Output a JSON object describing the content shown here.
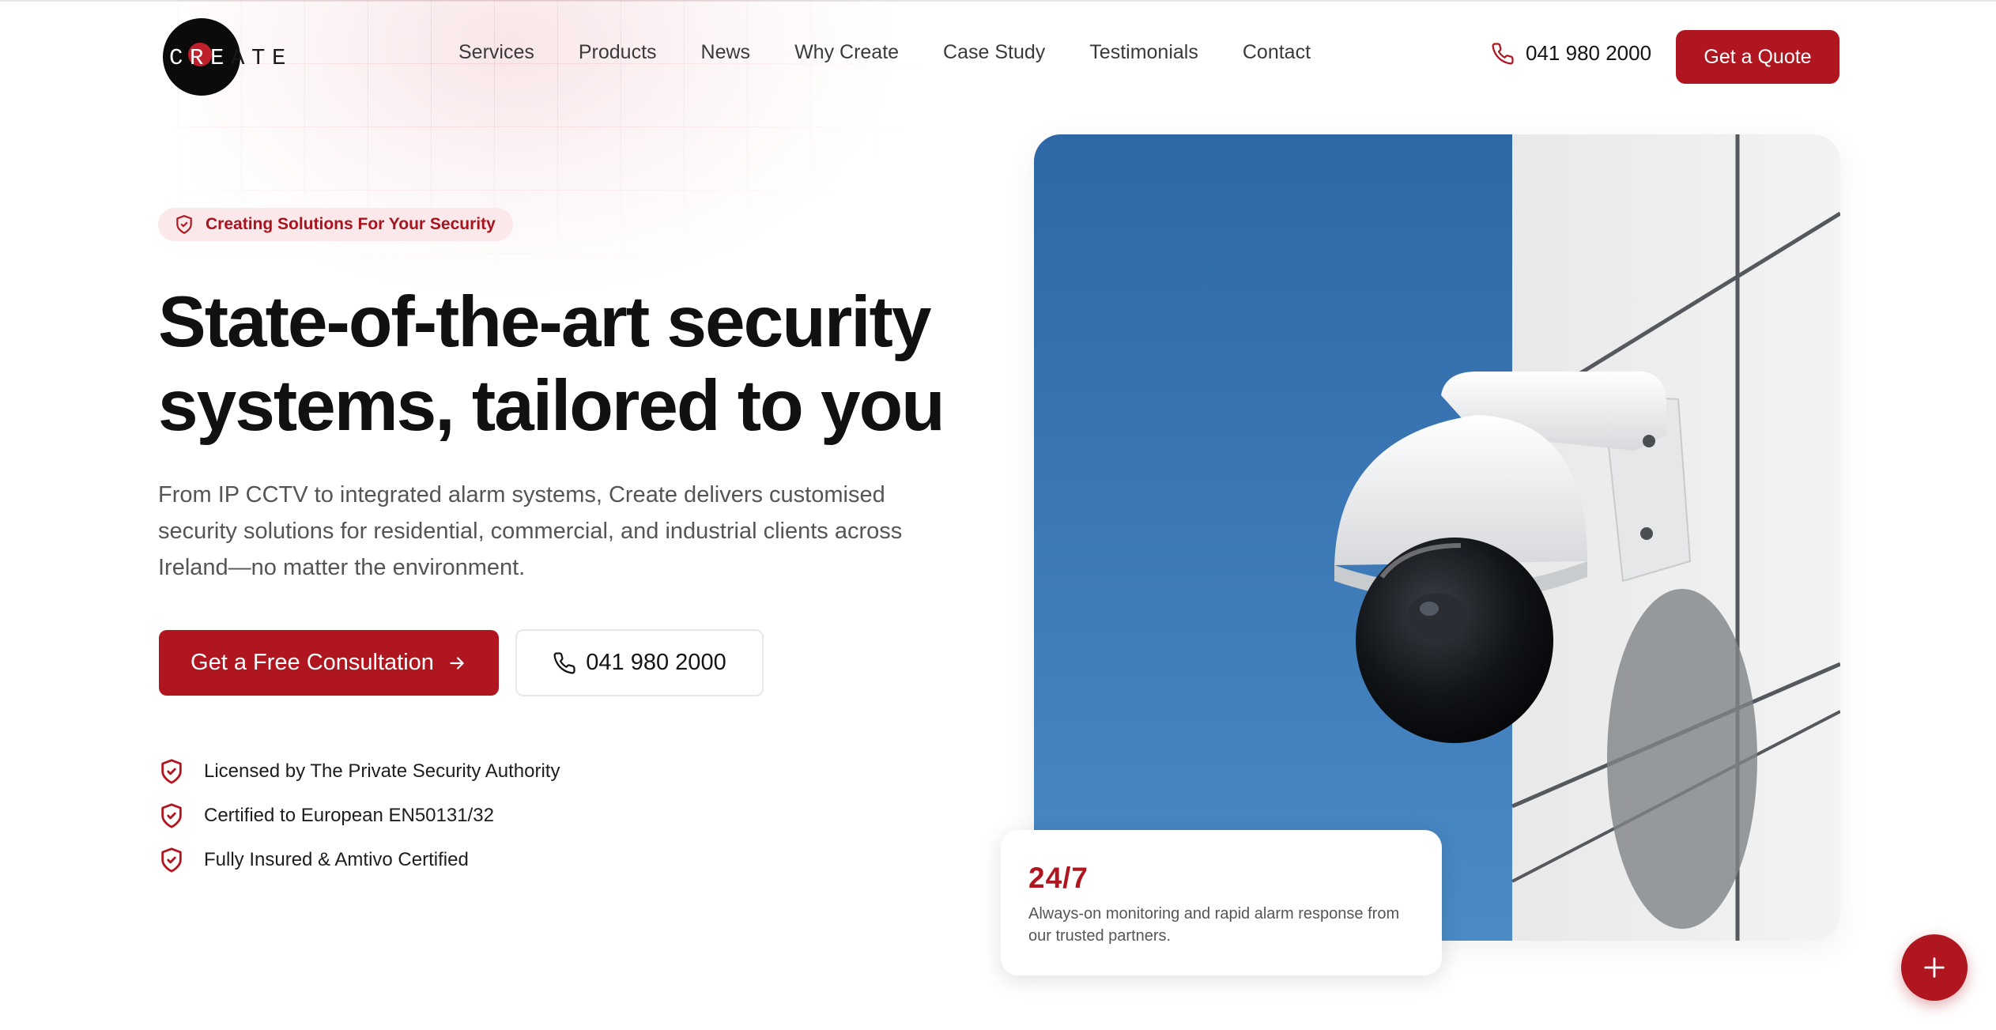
{
  "brand": {
    "logo_letters": [
      "C",
      "R",
      "E",
      "A",
      "T",
      "E"
    ]
  },
  "nav": {
    "items": [
      {
        "label": "Services"
      },
      {
        "label": "Products"
      },
      {
        "label": "News"
      },
      {
        "label": "Why Create"
      },
      {
        "label": "Case Study"
      },
      {
        "label": "Testimonials"
      },
      {
        "label": "Contact"
      }
    ]
  },
  "header": {
    "phone": "041 980 2000",
    "phone_icon": "phone-icon",
    "cta_label": "Get a Quote"
  },
  "hero": {
    "badge_icon": "shield-check-icon",
    "badge_text": "Creating Solutions For Your Security",
    "headline_line1": "State-of-the-art security",
    "headline_line2": "systems, tailored to you",
    "lede": "From IP CCTV to integrated alarm systems, Create delivers customised security solutions for residential, commercial, and industrial clients across Ireland—no matter the environment.",
    "primary_cta": "Get a Free Consultation",
    "primary_cta_icon": "arrow-right-icon",
    "secondary_cta": "041 980 2000",
    "secondary_cta_icon": "phone-icon",
    "credentials": [
      {
        "icon": "shield-check-icon",
        "text": "Licensed by The Private Security Authority"
      },
      {
        "icon": "shield-check-icon",
        "text": "Certified to European EN50131/32"
      },
      {
        "icon": "shield-check-icon",
        "text": "Fully Insured & Amtivo Certified"
      }
    ]
  },
  "stat": {
    "value": "24/7",
    "description": "Always-on monitoring and rapid alarm response from our trusted partners."
  },
  "fab": {
    "icon": "plus-icon"
  },
  "colors": {
    "accent": "#b0161f",
    "badge_bg": "#fbe8ea",
    "text_dark": "#111111",
    "text_muted": "#555555",
    "sky": "#3a78b5"
  }
}
